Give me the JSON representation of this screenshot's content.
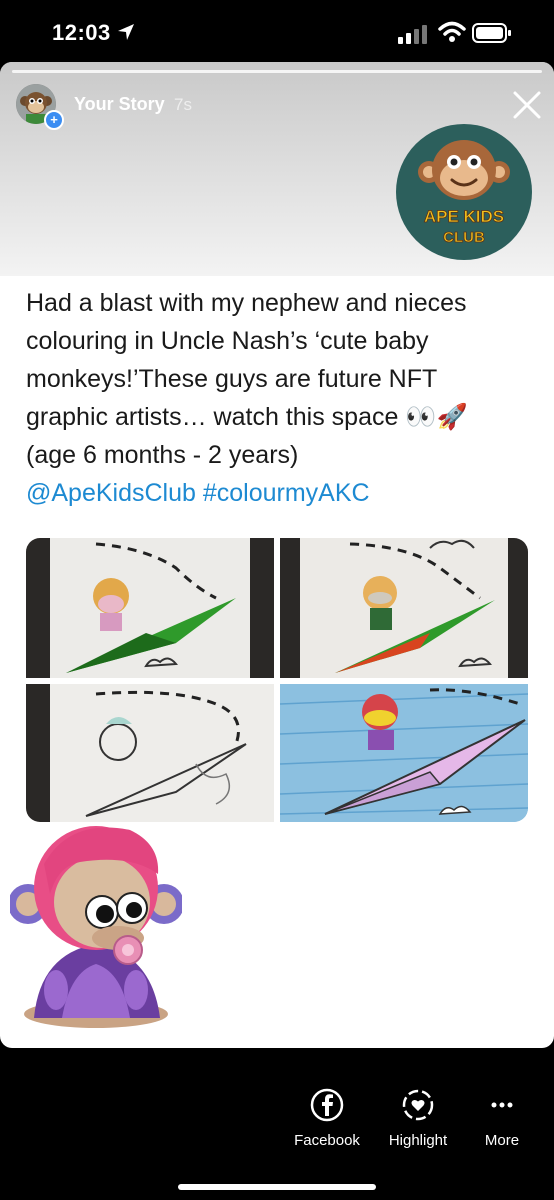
{
  "status_bar": {
    "time": "12:03"
  },
  "story": {
    "username": "Your Story",
    "timestamp": "7s",
    "logo_text_line1": "APE KIDS",
    "logo_text_line2": "CLUB"
  },
  "tweet": {
    "line1": "Had a blast with my nephew and nieces",
    "line2": "colouring in Uncle Nash’s ‘cute baby",
    "line3": "monkeys!’These guys are future NFT",
    "line4": "graphic artists… watch this space 👀🚀",
    "line5": "(age 6 months - 2 years)",
    "mentions": "@ApeKidsClub #colourmyAKC"
  },
  "actions": [
    {
      "label": "Facebook",
      "icon": "facebook-icon"
    },
    {
      "label": "Highlight",
      "icon": "highlight-heart-icon"
    },
    {
      "label": "More",
      "icon": "more-dots-icon"
    }
  ],
  "colors": {
    "mention_blue": "#1d8ad2",
    "logo_bg": "#2c5f5c",
    "avatar_badge": "#3b8df2"
  }
}
